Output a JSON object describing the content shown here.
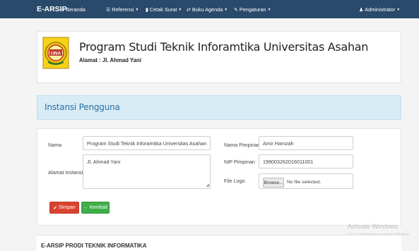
{
  "navbar": {
    "brand": "E-ARSIP",
    "items": [
      {
        "label": "Beranda",
        "icon": "home-icon"
      },
      {
        "label": "Referensi",
        "icon": "list-icon"
      },
      {
        "label": "Cetak Surat",
        "icon": "file-icon"
      },
      {
        "label": "Buku Agenda",
        "icon": "shuffle-icon"
      },
      {
        "label": "Pengaturan",
        "icon": "wrench-icon"
      }
    ],
    "user": {
      "label": "Administrator",
      "icon": "user-icon"
    }
  },
  "header": {
    "title": "Program Studi Teknik Inforamtika Universitas Asahan",
    "address": "Alamat : Jl. Ahmad Yani",
    "logo_text": "UNA"
  },
  "section": {
    "title": "Instansi Pengguna"
  },
  "form": {
    "nama_label": "Nama",
    "nama_value": "Program Studi Teknik Inforamtika Universitas Asahan",
    "alamat_label": "Alamat Instansi",
    "alamat_value": "Jl. Ahmad Yani",
    "pimpinan_label": "Nama Pimpinan",
    "pimpinan_value": "Amir Hamzah",
    "nip_label": "NIP Pimpinan",
    "nip_value": "199003262016011001",
    "logo_label": "File Logo",
    "browse_label": "Browse...",
    "file_status": "No file selected.",
    "save_label": "Simpan",
    "back_label": "Kembali"
  },
  "footer": {
    "text": "E-ARSIP PRODI TEKNIK INFORMATIKA"
  },
  "watermark": {
    "line1": "Activate Windows",
    "line2": "Go to Settings to activate Window"
  },
  "colors": {
    "navbar": "#2a4a6b",
    "section_bg": "#d8ecf6",
    "section_title": "#2c6e9e",
    "save": "#d9432f",
    "back": "#3fae49"
  }
}
